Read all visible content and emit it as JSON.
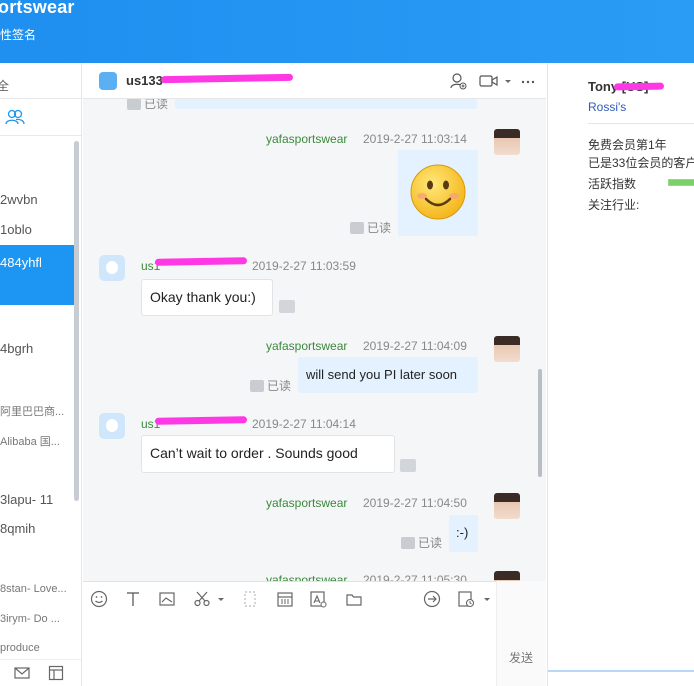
{
  "header": {
    "display_name": "ortswear",
    "signature": "性签名"
  },
  "left_panel": {
    "filter_label": "全",
    "contacts": [
      {
        "label": "2wvbn"
      },
      {
        "label": "1oblo"
      },
      {
        "label": "484yhfl"
      },
      {
        "label": "4bgrh"
      },
      {
        "label": "阿里巴巴商..."
      },
      {
        "label": "Alibaba 国..."
      },
      {
        "label": "3lapu- 11"
      },
      {
        "label": "8qmih"
      },
      {
        "label": "8stan- Love..."
      },
      {
        "label": "3irym- Do ..."
      },
      {
        "label": "produce"
      }
    ]
  },
  "chat": {
    "contact_title": "us133",
    "messages": [
      {
        "sender": "yafasportswear",
        "time": "2019-2-27 11:03:14",
        "content": "😊",
        "status": "已读"
      },
      {
        "sender": "us1",
        "time": "2019-2-27 11:03:59",
        "content": "Okay thank you:)"
      },
      {
        "sender": "yafasportswear",
        "time": "2019-2-27 11:04:09",
        "content": "will send you PI later soon",
        "status": "已读"
      },
      {
        "sender": "us1",
        "time": "2019-2-27 11:04:14",
        "content": "Can’t wait to order . Sounds good"
      },
      {
        "sender": "yafasportswear",
        "time": "2019-2-27 11:04:50",
        "content": ":-)",
        "status": "已读"
      },
      {
        "sender": "yafasportswear",
        "time": "2019-2-27 11:05:30"
      }
    ],
    "top_partial_status": "已读",
    "send_label": "发送"
  },
  "profile": {
    "name": "Tony [US]",
    "company": "Rossi's",
    "member_info": "免费会员第1年",
    "member_rank": "已是33位会员的客户",
    "activity_label": "活跃指数",
    "industry_label": "关注行业:",
    "activity_level": 0.5
  },
  "colors": {
    "accent": "#1c96f2",
    "sender_name": "#3a8a3a",
    "redaction": "#ff38e6"
  }
}
